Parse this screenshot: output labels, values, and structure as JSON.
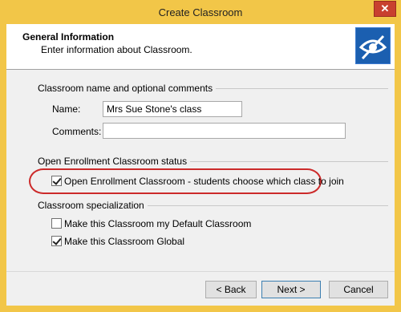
{
  "window": {
    "title": "Create Classroom",
    "close_glyph": "✕"
  },
  "header": {
    "title": "General Information",
    "subtitle": "Enter information about Classroom.",
    "logo_icon": "eye-logo-icon"
  },
  "sections": {
    "name_comments": {
      "label": "Classroom name and optional comments",
      "name_label": "Name:",
      "name_value": "Mrs Sue Stone's class",
      "comments_label": "Comments:",
      "comments_value": ""
    },
    "enrollment": {
      "label": "Open Enrollment Classroom status",
      "checkbox_label": "Open Enrollment Classroom - students choose which class to join",
      "checked": true
    },
    "specialization": {
      "label": "Classroom specialization",
      "default_label": "Make this Classroom my Default Classroom",
      "default_checked": false,
      "global_label": "Make this Classroom Global",
      "global_checked": true
    }
  },
  "buttons": {
    "back": "< Back",
    "next": "Next >",
    "cancel": "Cancel"
  },
  "colors": {
    "titlebar": "#f2c648",
    "highlight": "#cc2a2a",
    "logo": "#1b5fb0"
  }
}
